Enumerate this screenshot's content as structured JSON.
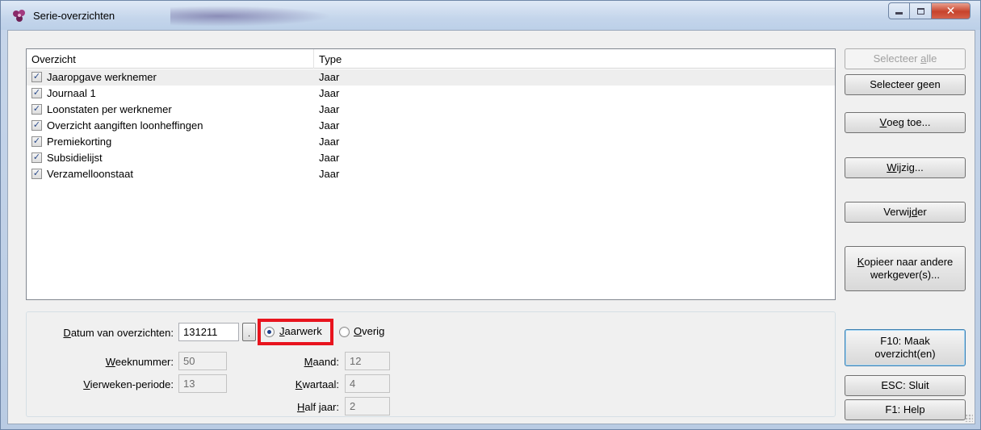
{
  "window": {
    "title": "Serie-overzichten",
    "icon": "purple-flower-icon",
    "controls": [
      "minimize-icon",
      "maximize-icon",
      "close-icon"
    ]
  },
  "list": {
    "columns": [
      "Overzicht",
      "Type"
    ],
    "rows": [
      {
        "name": "Jaaropgave werknemer",
        "type": "Jaar",
        "checked": true,
        "selected": true
      },
      {
        "name": "Journaal 1",
        "type": "Jaar",
        "checked": true
      },
      {
        "name": "Loonstaten per werknemer",
        "type": "Jaar",
        "checked": true
      },
      {
        "name": "Overzicht aangiften loonheffingen",
        "type": "Jaar",
        "checked": true
      },
      {
        "name": "Premiekorting",
        "type": "Jaar",
        "checked": true
      },
      {
        "name": "Subsidielijst",
        "type": "Jaar",
        "checked": true
      },
      {
        "name": "Verzamelloonstaat",
        "type": "Jaar",
        "checked": true
      }
    ]
  },
  "buttons": {
    "select_all_a": "Selecteer ",
    "select_all_b": "a",
    "select_all_c": "lle",
    "select_none_a": "Selecteer ",
    "select_none_b": "g",
    "select_none_c": "een",
    "add_a": "",
    "add_b": "V",
    "add_c": "oeg toe...",
    "edit_a": "",
    "edit_b": "W",
    "edit_c": "ijzig...",
    "remove_a": "Verwij",
    "remove_b": "d",
    "remove_c": "er",
    "copy_a": "",
    "copy_b": "K",
    "copy_c": "opieer naar andere",
    "copy_line2": "werkgever(s)...",
    "make_line1": "F10: Maak",
    "make_line2": "overzicht(en)",
    "close": "ESC: Sluit",
    "help": "F1: Help"
  },
  "form": {
    "date_label_a": "",
    "date_label_b": "D",
    "date_label_c": "atum van overzichten:",
    "date_value": "131211",
    "date_button": ".",
    "radio_jaarwerk_b": "J",
    "radio_jaarwerk_c": "aarwerk",
    "radio_overig_b": "O",
    "radio_overig_c": "verig",
    "week_label_b": "W",
    "week_label_c": "eeknummer:",
    "week_value": "50",
    "vierweken_label_b": "V",
    "vierweken_label_c": "ierweken-periode:",
    "vierweken_value": "13",
    "maand_label_b": "M",
    "maand_label_c": "aand:",
    "maand_value": "12",
    "kwartaal_label_b": "K",
    "kwartaal_label_c": "wartaal:",
    "kwartaal_value": "4",
    "halfjaar_label_b": "H",
    "halfjaar_label_c": "alf jaar:",
    "halfjaar_value": "2"
  },
  "colors": {
    "highlight": "#e8141e",
    "accent_radio": "#1c3f8a"
  }
}
